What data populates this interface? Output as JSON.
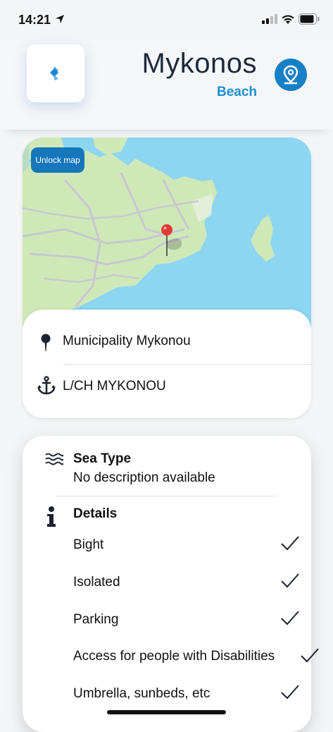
{
  "status_bar": {
    "time": "14:21"
  },
  "header": {
    "title": "Mykonos",
    "subtitle": "Beach"
  },
  "map": {
    "unlock_label": "Unlock map"
  },
  "location": {
    "municipality": "Municipality Mykonou",
    "port": "L/CH MYKONOU"
  },
  "sea_type": {
    "title": "Sea Type",
    "description": "No description available"
  },
  "details": {
    "title": "Details",
    "items": [
      {
        "label": "Bight",
        "checked": true
      },
      {
        "label": "Isolated",
        "checked": true
      },
      {
        "label": "Parking",
        "checked": true
      },
      {
        "label": "Access for people with Disabilities",
        "checked": true
      },
      {
        "label": "Umbrella, sunbeds, etc",
        "checked": true
      }
    ]
  },
  "colors": {
    "accent": "#1680c6",
    "subtitle": "#1e8fd0",
    "sea": "#8dd6f2",
    "land": "#cfe8b8",
    "pin": "#e53935"
  }
}
